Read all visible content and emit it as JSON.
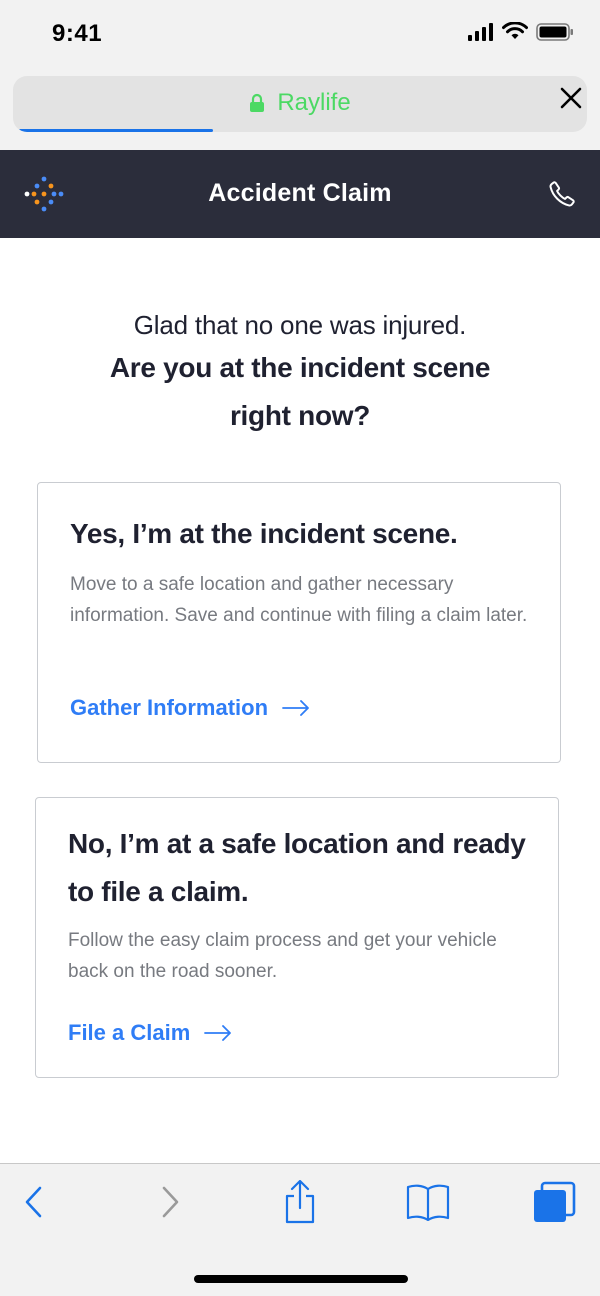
{
  "status_bar": {
    "time": "9:41",
    "icons": [
      "cellular-signal-icon",
      "wifi-icon",
      "battery-icon"
    ]
  },
  "browser": {
    "url": "Raylife",
    "url_color": "#4cd964",
    "icons": [
      "lock-icon",
      "close-icon"
    ]
  },
  "header": {
    "title": "Accident Claim",
    "background": "#2b2d3b",
    "icons": [
      "raylife-logo",
      "phone-icon"
    ]
  },
  "question": {
    "line1": "Glad that no one was injured.",
    "line2": "Are you at the incident scene",
    "line3": "right now?"
  },
  "cards": [
    {
      "title": "Yes, I’m at the incident scene.",
      "body": "Move to a safe location and gather necessary information. Save and continue with filing a claim later.",
      "link": "Gather Information"
    },
    {
      "title": "No, I’m at a safe location and ready to file a claim.",
      "body": "Follow the easy claim process and get your vehicle back on the road sooner.",
      "link": "File a Claim"
    }
  ],
  "toolbar": {
    "icons": [
      "back-icon",
      "forward-icon",
      "share-icon",
      "bookmarks-icon",
      "tabs-icon"
    ]
  },
  "colors": {
    "accent": "#2f7df6",
    "ios_blue": "#1a73e8"
  }
}
